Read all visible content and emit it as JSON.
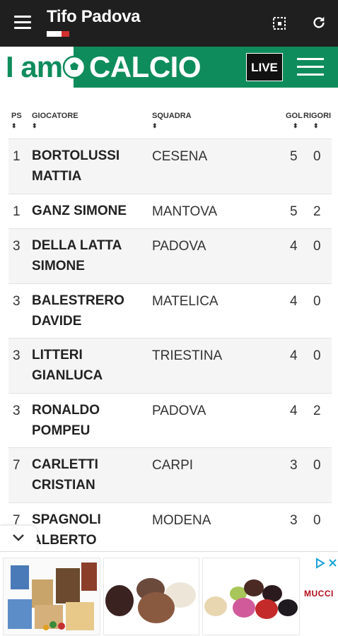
{
  "app_bar": {
    "title": "Tifo Padova",
    "icons": [
      "menu-icon",
      "qr-scan-icon",
      "refresh-icon"
    ],
    "flag_colors": [
      "#ffffff",
      "#ffffff",
      "#d32f2f"
    ]
  },
  "brand": {
    "logo_left": "I am",
    "logo_right": "CALCIO",
    "live_label": "LIVE",
    "accent_color": "#0f8c5c"
  },
  "table": {
    "headers": {
      "ps": "PS",
      "player": "GIOCATORE",
      "team": "SQUADRA",
      "gol": "GOL",
      "rigori": "RIGORI"
    },
    "rows": [
      {
        "ps": "1",
        "player": "BORTOLUSSI MATTIA",
        "team": "CESENA",
        "gol": "5",
        "rigori": "0"
      },
      {
        "ps": "1",
        "player": "GANZ SIMONE",
        "team": "MANTOVA",
        "gol": "5",
        "rigori": "2"
      },
      {
        "ps": "3",
        "player": "DELLA LATTA SIMONE",
        "team": "PADOVA",
        "gol": "4",
        "rigori": "0"
      },
      {
        "ps": "3",
        "player": "BALESTRERO DAVIDE",
        "team": "MATELICA",
        "gol": "4",
        "rigori": "0"
      },
      {
        "ps": "3",
        "player": "LITTERI GIANLUCA",
        "team": "TRIESTINA",
        "gol": "4",
        "rigori": "0"
      },
      {
        "ps": "3",
        "player": "RONALDO POMPEU",
        "team": "PADOVA",
        "gol": "4",
        "rigori": "2"
      },
      {
        "ps": "7",
        "player": "CARLETTI CRISTIAN",
        "team": "CARPI",
        "gol": "3",
        "rigori": "0"
      },
      {
        "ps": "7",
        "player": "SPAGNOLI ALBERTO",
        "team": "MODENA",
        "gol": "3",
        "rigori": "0"
      }
    ]
  },
  "ad": {
    "brand_text": "MUCCI",
    "icons": [
      "adchoices-icon",
      "close-icon",
      "chevron-down-icon"
    ]
  }
}
